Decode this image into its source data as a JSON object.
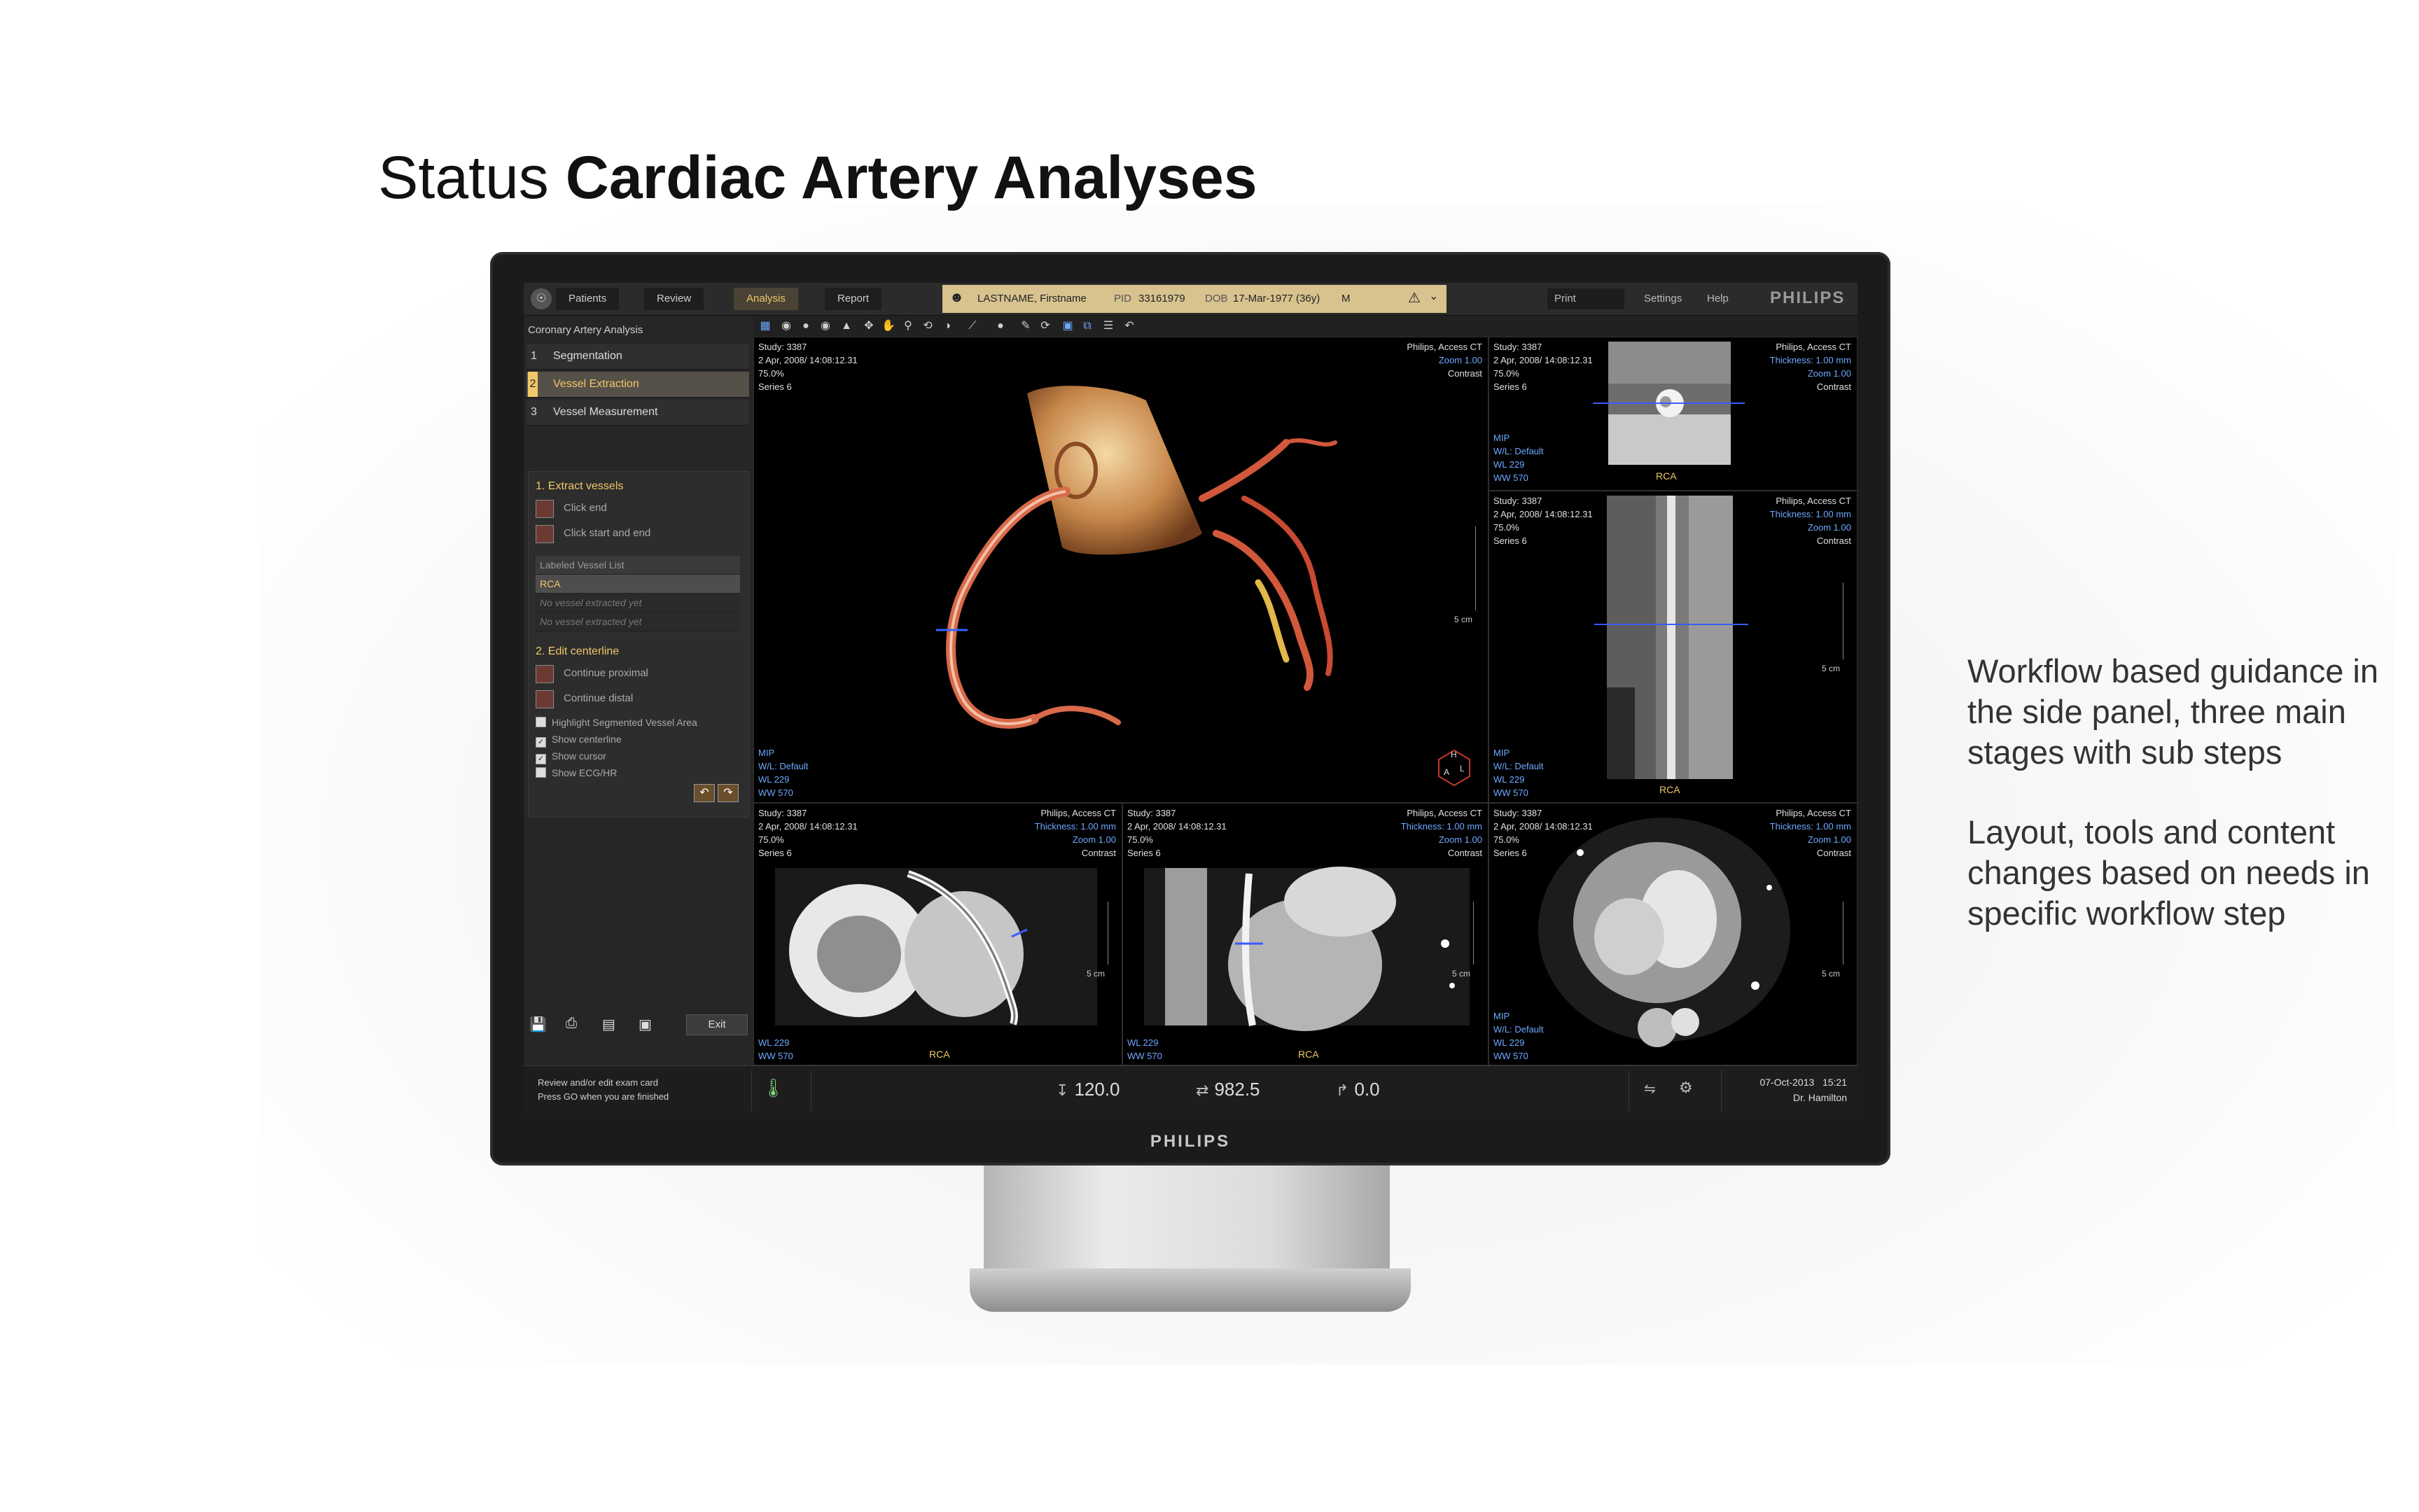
{
  "slide": {
    "title_light": "Status",
    "title_bold": "Cardiac Artery Analyses",
    "note_1": "Workflow based guidance in the side panel, three main stages with sub steps",
    "note_2": "Layout, tools and content changes based on needs in specific workflow step"
  },
  "monitor": {
    "brand": "PHILIPS"
  },
  "topbar": {
    "tabs": [
      {
        "label": "Patients"
      },
      {
        "label": "Review"
      },
      {
        "label": "Analysis",
        "active": true
      },
      {
        "label": "Report"
      }
    ],
    "patient": {
      "name": "LASTNAME, Firstname",
      "pid_label": "PID",
      "pid": "33161979",
      "dob_label": "DOB",
      "dob": "17-Mar-1977 (36y)",
      "sex": "M",
      "warning_icon": "warning-triangle-icon"
    },
    "print": "Print",
    "settings": "Settings",
    "help": "Help",
    "logo": "PHILIPS"
  },
  "sidepanel": {
    "title": "Coronary Artery Analysis",
    "steps": [
      {
        "num": "1",
        "label": "Segmentation"
      },
      {
        "num": "2",
        "label": "Vessel Extraction",
        "active": true
      },
      {
        "num": "3",
        "label": "Vessel Measurement"
      }
    ],
    "extract": {
      "heading": "1. Extract vessels",
      "click_end": "Click end",
      "click_start_end": "Click start and end",
      "list_header": "Labeled Vessel List",
      "selected_vessel": "RCA",
      "empty_1": "No vessel extracted yet",
      "empty_2": "No vessel extracted yet"
    },
    "edit": {
      "heading": "2. Edit centerline",
      "continue_proximal": "Continue proximal",
      "continue_distal": "Continue distal",
      "checks": [
        {
          "label": "Highlight Segmented Vessel Area",
          "checked": false
        },
        {
          "label": "Show centerline",
          "checked": true
        },
        {
          "label": "Show cursor",
          "checked": true
        },
        {
          "label": "Show ECG/HR",
          "checked": false
        }
      ]
    },
    "exit": "Exit"
  },
  "viewport_common": {
    "study": "Study: 3387",
    "date": "2 Apr, 2008/ 14:08:12.31",
    "pct": "75.0%",
    "series": "Series 6",
    "inst": "Philips, Access CT",
    "thickness": "Thickness: 1.00 mm",
    "zoom": "Zoom 1.00",
    "contrast": "Contrast",
    "mip": "MIP",
    "wl_default": "W/L: Default",
    "wl": "WL 229",
    "ww": "WW 570",
    "scale": "5 cm",
    "vessel": "RCA"
  },
  "orientation": {
    "h": "H",
    "a": "A",
    "l": "L"
  },
  "statusbar": {
    "message_1": "Review and/or edit exam card",
    "message_2": "Press GO when you are finished",
    "value_1": "120.0",
    "value_2": "982.5",
    "value_3": "0.0",
    "date": "07-Oct-2013",
    "time": "15:21",
    "user": "Dr. Hamilton"
  }
}
